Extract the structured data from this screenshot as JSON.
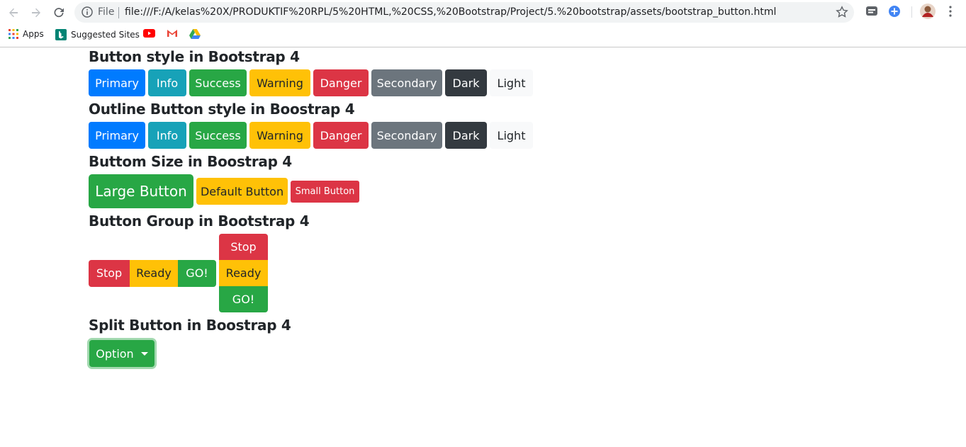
{
  "browser": {
    "file_label": "File",
    "url": "file:///F:/A/kelas%20X/PRODUKTIF%20RPL/5%20HTML,%20CSS,%20Bootstrap/Project/5.%20bootstrap/assets/bootstrap_button.html",
    "bookmarks": [
      {
        "label": "Apps",
        "icon": "apps-grid-icon"
      },
      {
        "label": "Suggested Sites",
        "icon": "bing-icon"
      },
      {
        "label": "",
        "icon": "youtube-icon"
      },
      {
        "label": "",
        "icon": "gmail-icon"
      },
      {
        "label": "",
        "icon": "drive-icon"
      }
    ]
  },
  "sections": {
    "button_style": {
      "title": "Button style in Bootstrap 4",
      "buttons": [
        "Primary",
        "Info",
        "Success",
        "Warning",
        "Danger",
        "Secondary",
        "Dark",
        "Light"
      ]
    },
    "outline_style": {
      "title": "Outline Button style in Boostrap 4",
      "buttons": [
        "Primary",
        "Info",
        "Success",
        "Warning",
        "Danger",
        "Secondary",
        "Dark",
        "Light"
      ]
    },
    "size": {
      "title": "Buttom Size in Boostrap 4",
      "large": "Large Button",
      "default": "Default Button",
      "small": "Small Button"
    },
    "group": {
      "title": "Button Group in Bootstrap 4",
      "horizontal": [
        "Stop",
        "Ready",
        "GO!"
      ],
      "vertical": [
        "Stop",
        "Ready",
        "GO!"
      ]
    },
    "split": {
      "title": "Split Button in Boostrap 4",
      "option_label": "Option"
    }
  },
  "colors": {
    "primary": "#007bff",
    "info": "#17a2b8",
    "success": "#28a745",
    "warning": "#ffc107",
    "danger": "#dc3545",
    "secondary": "#6c757d",
    "dark": "#343a40",
    "light": "#f8f9fa"
  }
}
